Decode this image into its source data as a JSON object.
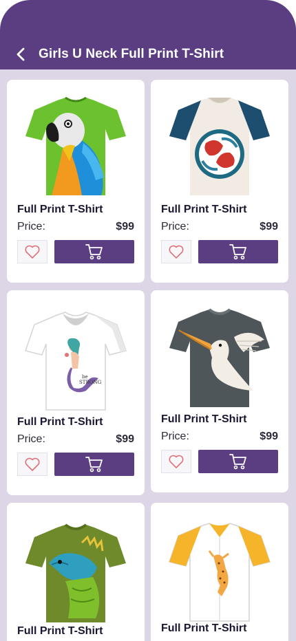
{
  "header": {
    "title": "Girls U Neck Full Print T-Shirt",
    "back_icon": "chevron-left-icon"
  },
  "colors": {
    "header_bg": "#5b3e82",
    "page_bg": "#dcd6e6",
    "card_bg": "#ffffff",
    "cart_button": "#5b3e82",
    "heart": "#e0717a"
  },
  "products": [
    {
      "name": "Full Print T-Shirt",
      "price_label": "Price:",
      "price": "$99",
      "image": "parrot-print-shirt"
    },
    {
      "name": "Full Print T-Shirt",
      "price_label": "Price:",
      "price": "$99",
      "image": "koi-fish-print-shirt"
    },
    {
      "name": "Full Print T-Shirt",
      "price_label": "Price:",
      "price": "$99",
      "image": "mermaid-print-shirt"
    },
    {
      "name": "Full Print T-Shirt",
      "price_label": "Price:",
      "price": "$99",
      "image": "pelican-print-shirt"
    },
    {
      "name": "Full Print T-Shirt",
      "image": "iguana-print-shirt"
    },
    {
      "name": "Full Print T-Shirt",
      "image": "leopard-print-shirt"
    }
  ]
}
